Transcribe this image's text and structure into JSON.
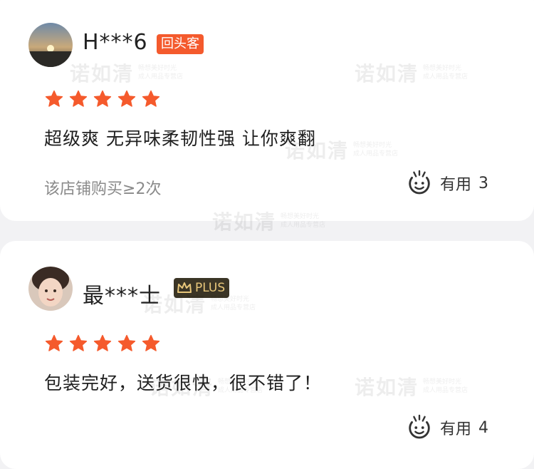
{
  "watermark": {
    "brand": "诺如清",
    "line1": "畅想美好时光",
    "line2": "成人用品专营店"
  },
  "reviews": [
    {
      "user": "H***6",
      "badge": "回头客",
      "rating": 5,
      "text": "超级爽 无异味柔韧性强 让你爽翻",
      "purchase_prefix": "该店铺购买≥",
      "purchase_count": "2",
      "purchase_suffix": "次",
      "useful_label": "有用",
      "useful_count": "3"
    },
    {
      "user": "最***士",
      "badge": "PLUS",
      "rating": 5,
      "text": "包装完好，送货很快，很不错了！",
      "useful_label": "有用",
      "useful_count": "4"
    }
  ],
  "colors": {
    "star": "#f55a2c",
    "badge_hui": "#f45a2d",
    "badge_plus_bg": "#3b3526",
    "badge_plus_fg": "#e8c77b"
  },
  "icons": {
    "useful": "thumb-smiley-icon",
    "crown": "crown-icon",
    "star": "star-icon"
  }
}
